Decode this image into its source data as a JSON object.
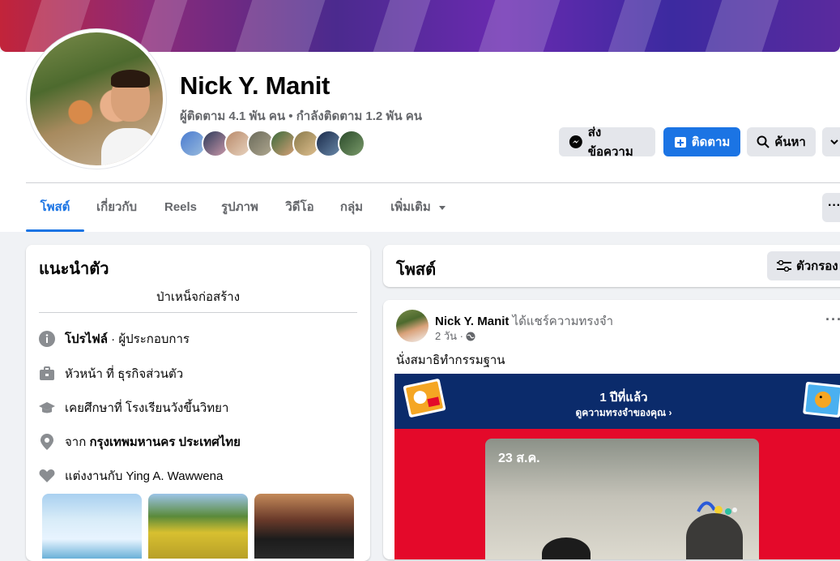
{
  "profile": {
    "name": "Nick Y. Manit",
    "stats": "ผู้ติดตาม 4.1 พัน คน • กำลังติดตาม 1.2 พัน คน"
  },
  "actions": {
    "message": "ส่งข้อความ",
    "follow": "ติดตาม",
    "search": "ค้นหา"
  },
  "tabs": [
    "โพสต์",
    "เกี่ยวกับ",
    "Reels",
    "รูปภาพ",
    "วิดีโอ",
    "กลุ่ม",
    "เพิ่มเติม"
  ],
  "intro": {
    "title": "แนะนำตัว",
    "bio": "ป่าเหน็จก่อสร้าง",
    "profile_label": "โปรไฟล์",
    "profile_type": " · ผู้ประกอบการ",
    "work": "หัวหน้า ที่ ธุรกิจส่วนตัว",
    "education": "เคยศึกษาที่ โรงเรียนวังขึ้นวิทยา",
    "from_prefix": "จาก ",
    "from_place": "กรุงเทพมหานคร ประเทศไทย",
    "married_prefix": "แต่งงานกับ ",
    "married_to": "Ying A. Wawwena"
  },
  "posts_section": {
    "title": "โพสต์",
    "filter_label": "ตัวกรอง"
  },
  "post": {
    "author": "Nick Y. Manit",
    "action": " ได้แชร์ความทรงจำ",
    "time": "2 วัน ·",
    "text": "นั่งสมาธิทำกรรมฐาน",
    "memory_title": "1 ปีที่แล้ว",
    "memory_link": "ดูความทรงจำของคุณ",
    "memory_date": "23 ส.ค."
  },
  "colors": {
    "accent": "#1b74e4",
    "memory_banner": "#0b2b6b",
    "memory_bg": "#e4092a"
  }
}
